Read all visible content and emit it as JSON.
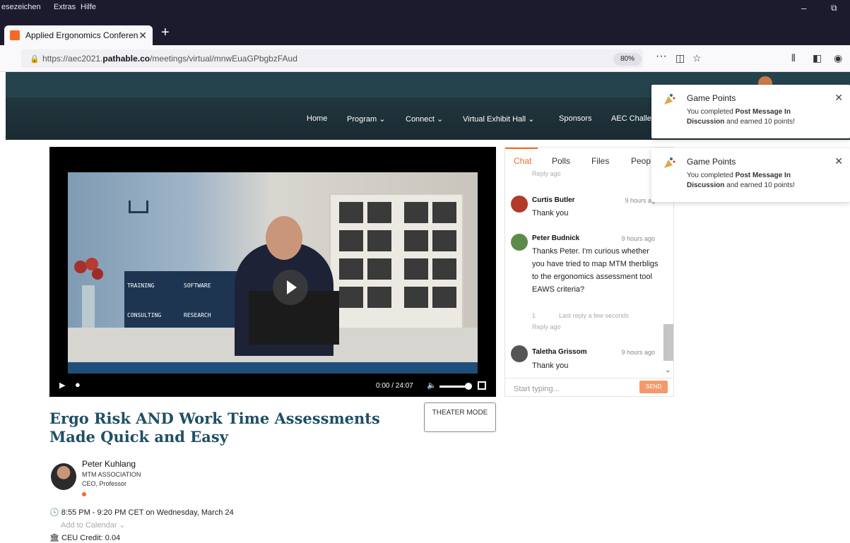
{
  "browser": {
    "menus": [
      "esezeichen",
      "Extras",
      "Hilfe"
    ],
    "window_controls": [
      "–",
      "⧉"
    ],
    "tab_title": "Applied Ergonomics Conferenc",
    "tab_close": "✕",
    "new_tab": "+",
    "url_prefix": "https://aec2021.",
    "url_host": "pathable.co",
    "url_path": "/meetings/virtual/mnwEuaGPbgbzFAud",
    "zoom": "80%",
    "more": "···"
  },
  "nav": {
    "items": [
      "Home",
      "Program ⌄",
      "Connect ⌄",
      "Virtual Exhibit Hall ⌄",
      "Sponsors",
      "AEC Challe"
    ]
  },
  "video": {
    "banner_words": [
      "TRAINING",
      "SOFTWARE",
      "CONSULTING",
      "RESEARCH"
    ],
    "time": "0:00 / 24:07"
  },
  "talk": {
    "title": "Ergo Risk AND Work Time Assessments Made Quick and Easy",
    "theater_label": "THEATER MODE",
    "speaker_name": "Peter Kuhlang",
    "speaker_org": "MTM ASSOCIATION",
    "speaker_role": "CEO, Professor",
    "time": "8:55 PM - 9:20 PM CET on Wednesday, March 24",
    "add_calendar": "Add to Calendar ⌄",
    "ceu": "CEU Credit: 0.04"
  },
  "chat": {
    "tabs": [
      "Chat",
      "Polls",
      "Files",
      "Peop"
    ],
    "top_meta": "Reply   ago",
    "messages": [
      {
        "author": "Curtis Butler",
        "time": "9 hours ag",
        "text": "Thank you"
      },
      {
        "author": "Peter Budnick",
        "time": "9 hours ago",
        "text": "Thanks Peter. I'm curious whether you have tried to map MTM therbligs to the ergonomics assessment tool EAWS criteria?",
        "reply_count": "1",
        "last_reply": "Last reply a few seconds",
        "reply_meta": "Reply   ago"
      },
      {
        "author": "Taletha Grissom",
        "time": "9 hours ago",
        "text": "Thank you"
      }
    ],
    "input_placeholder": "Start typing...",
    "send_label": "SEND"
  },
  "notifications": [
    {
      "title": "Game Points",
      "body_prefix": "You completed ",
      "body_bold": "Post Message In Discussion",
      "body_suffix": " and earned 10 points!"
    },
    {
      "title": "Game Points",
      "body_prefix": "You completed ",
      "body_bold": "Post Message In Discussion",
      "body_suffix": " and earned 10 points!"
    }
  ],
  "colors": {
    "accent": "#f46a25",
    "title": "#1e4f65",
    "nav_bg": "#1a2b31"
  }
}
